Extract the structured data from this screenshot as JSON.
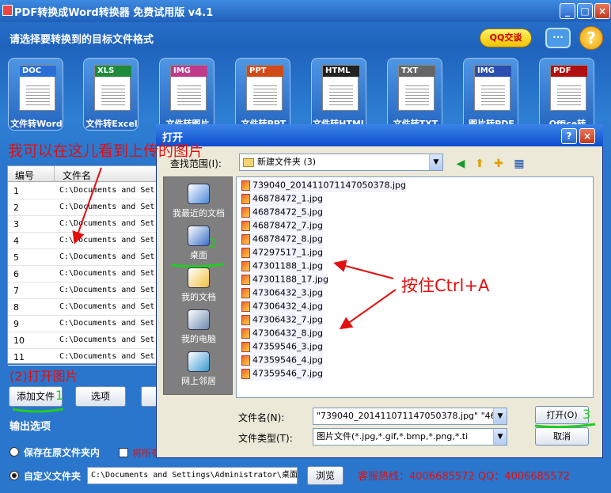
{
  "app": {
    "title": "PDF转换成Word转换器 免费试用版 v4.1",
    "prompt": "请选择要转换到的目标文件格式",
    "qq_chat": "QQ交谈",
    "help_glyph": "?"
  },
  "tools": [
    {
      "tag": "DOC",
      "label": "文件转Word",
      "color": "#2b6fd6"
    },
    {
      "tag": "XLS",
      "label": "文件转Excel",
      "color": "#1e8a3a"
    },
    {
      "tag": "IMG",
      "label": "文件转图片",
      "color": "#c03a8a"
    },
    {
      "tag": "PPT",
      "label": "文件转PPT",
      "color": "#d04a1a"
    },
    {
      "tag": "HTML",
      "label": "文件转HTML",
      "color": "#222222"
    },
    {
      "tag": "TXT",
      "label": "文件转TXT",
      "color": "#666666"
    },
    {
      "tag": "IMG",
      "label": "图片转PDF",
      "color": "#2a4fb0"
    },
    {
      "tag": "PDF",
      "label": "Office转PDF",
      "color": "#b01010"
    }
  ],
  "list": {
    "col_no": "编号",
    "col_name": "文件名",
    "rows": [
      {
        "n": "1",
        "path": "C:\\Documents and Set"
      },
      {
        "n": "2",
        "path": "C:\\Documents and Set"
      },
      {
        "n": "3",
        "path": "C:\\Documents and Set"
      },
      {
        "n": "4",
        "path": "C:\\Documents and Set"
      },
      {
        "n": "5",
        "path": "C:\\Documents and Set"
      },
      {
        "n": "6",
        "path": "C:\\Documents and Set"
      },
      {
        "n": "7",
        "path": "C:\\Documents and Set"
      },
      {
        "n": "8",
        "path": "C:\\Documents and Set"
      },
      {
        "n": "9",
        "path": "C:\\Documents and Set"
      },
      {
        "n": "10",
        "path": "C:\\Documents and Set"
      },
      {
        "n": "11",
        "path": "C:\\Documents and Set"
      }
    ]
  },
  "buttons": {
    "add_file": "添加文件",
    "options": "选项",
    "browse": "浏览"
  },
  "output": {
    "section": "输出选项",
    "opt_source": "保存在原文件夹内",
    "opt_open_after": "将所有",
    "opt_custom": "自定义文件夹",
    "custom_path": "C:\\Documents and Settings\\Administrator\\桌面",
    "hotline": "客服热线：4006685572 QQ：4006685572"
  },
  "annotations": {
    "can_see": "我可以在这儿看到上传的图片",
    "open_images": "(2)打开图片",
    "step1": "1",
    "step2": "2",
    "step3": "3",
    "ctrl_a": "按住Ctrl+A"
  },
  "dialog": {
    "title": "打开",
    "lookin_label": "查找范围(I):",
    "lookin_value": "新建文件夹 (3)",
    "places": [
      {
        "label": "我最近的文档",
        "icon": "recent-documents-icon"
      },
      {
        "label": "桌面",
        "icon": "desktop-icon"
      },
      {
        "label": "我的文档",
        "icon": "my-documents-icon"
      },
      {
        "label": "我的电脑",
        "icon": "my-computer-icon"
      },
      {
        "label": "网上邻居",
        "icon": "network-places-icon"
      }
    ],
    "files": [
      "739040_20141107114705037​8.jpg",
      "46878472_1.jpg",
      "46878472_5.jpg",
      "46878472_7.jpg",
      "46878472_8.jpg",
      "47297517_1.jpg",
      "47301188_1.jpg",
      "47301188_17.jpg",
      "47306432_3.jpg",
      "47306432_4.jpg",
      "47306432_7.jpg",
      "47306432_8.jpg",
      "47359546_3.jpg",
      "47359546_4.jpg",
      "47359546_7.jpg"
    ],
    "filename_label": "文件名(N):",
    "filename_value": "\"739040_20141107114705037​8.jpg\" \"4687",
    "filetype_label": "文件类型(T):",
    "filetype_value": "图片文件(*.jpg,*.gif,*.bmp,*.png,*.ti",
    "open_button": "打开(O)",
    "cancel_button": "取消"
  }
}
